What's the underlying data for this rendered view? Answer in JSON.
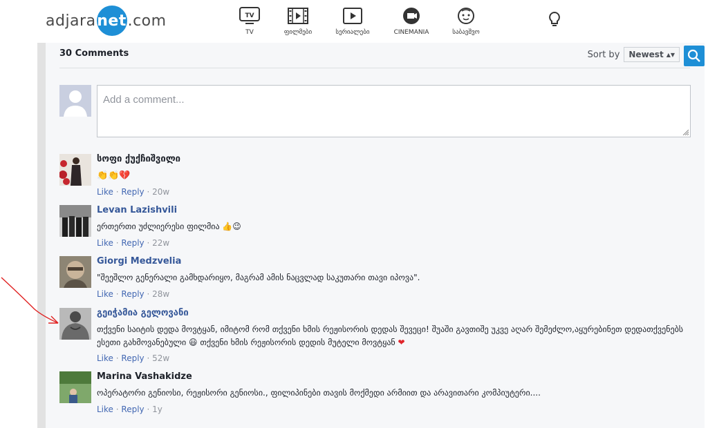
{
  "site": {
    "logo_prefix": "adjara",
    "logo_accent": "net",
    "logo_suffix": ".com",
    "brand_color": "#1e8fd6"
  },
  "nav": [
    {
      "label": "TV",
      "icon": "tv-icon"
    },
    {
      "label": "ფილმები",
      "icon": "film-strip-icon"
    },
    {
      "label": "სერიალები",
      "icon": "play-icon"
    },
    {
      "label": "CINEMANIA",
      "icon": "cinemania-icon"
    },
    {
      "label": "საბავშვო",
      "icon": "kids-face-icon"
    }
  ],
  "tv_icon_text": "TV",
  "comments_header": {
    "count_text": "30 Comments",
    "sort_label": "Sort by",
    "sort_value": "Newest"
  },
  "composer": {
    "placeholder": "Add a comment..."
  },
  "actions": {
    "like": "Like",
    "reply": "Reply",
    "sep": "·"
  },
  "comments": [
    {
      "author": "სოფი ქუქჩიშვილი",
      "text": "👏👏💔",
      "age": "20w"
    },
    {
      "author": "Levan Lazishvili",
      "text": "ერთერთი უძლიერესი ფილმია 👍😉",
      "age": "22w"
    },
    {
      "author": "Giorgi Medzvelia",
      "text": "\"შეეშლო გენერალი გამხდარიყო, მაგრამ ამის ნაცვლად საკუთარი თავი იპოვა\".",
      "age": "28w"
    },
    {
      "author": "გეიჭამია გელოვანი",
      "text": "თქვენი საიტის დედა მოვტყან, იმიტომ რომ თქვენი ხმის რეჟისორის დედას შევეცი! შუაში გავთიშე უკვე აღარ შემეძლო,აყურებინეთ დედათქვენებს ესეთი გახმოვანებული 😃 თქვენი ხმის რეჟისორის დედის მუტელი მოვტყან",
      "heart": "❤",
      "age": "52w"
    },
    {
      "author": "Marina Vashakidze",
      "text": "ოპერატორი გენიოსი, რეჟისორი გენიოსი., ფილიპინები თავის მოქმედი არმიით და არავითარი კომპიუტერი....",
      "age": "1y"
    }
  ]
}
